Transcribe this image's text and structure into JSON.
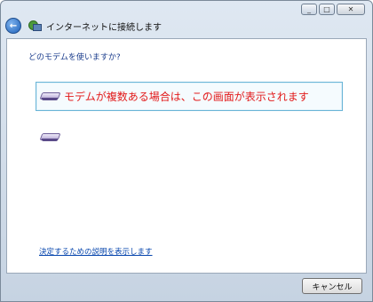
{
  "window": {
    "title": "インターネットに接続します",
    "controls": {
      "minimize": "_",
      "maximize": "□",
      "close": "✕"
    }
  },
  "main": {
    "prompt": "どのモデムを使いますか?",
    "options": [
      {
        "label": "モデムが複数ある場合は、この画面が表示されます",
        "selected": true,
        "icon": "modem-icon"
      },
      {
        "label": "",
        "selected": false,
        "icon": "modem-icon"
      }
    ],
    "help_link": "決定するための説明を表示します"
  },
  "footer": {
    "cancel_label": "キャンセル"
  },
  "colors": {
    "annotation_red": "#e21a1a",
    "link_blue": "#0645ad",
    "selection_border": "#6ab5d7"
  }
}
